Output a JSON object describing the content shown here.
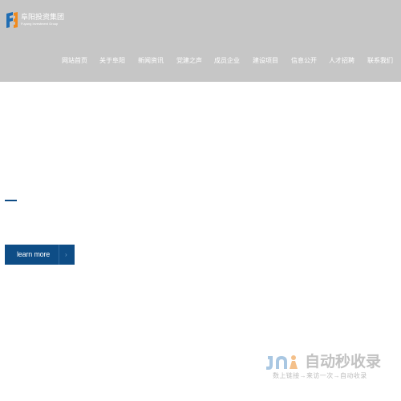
{
  "header": {
    "logo": {
      "name_cn": "阜阳投资集团",
      "name_en": "Fuyang Investment Group"
    },
    "nav": [
      "网站首页",
      "关于阜阳",
      "新闻资讯",
      "党建之声",
      "成员企业",
      "建设项目",
      "信息公开",
      "人才招聘",
      "联系我们"
    ]
  },
  "hero": {
    "button_label": "learn more",
    "button_arrow": "›"
  },
  "watermark": {
    "title": "自动秒收录",
    "subtitle": "数上链接→来访一次→自动收录"
  },
  "colors": {
    "header_bg": "#c6c6c6",
    "accent": "#0e4d86",
    "logo_blue": "#1f6db3",
    "logo_orange": "#f08a1d"
  }
}
